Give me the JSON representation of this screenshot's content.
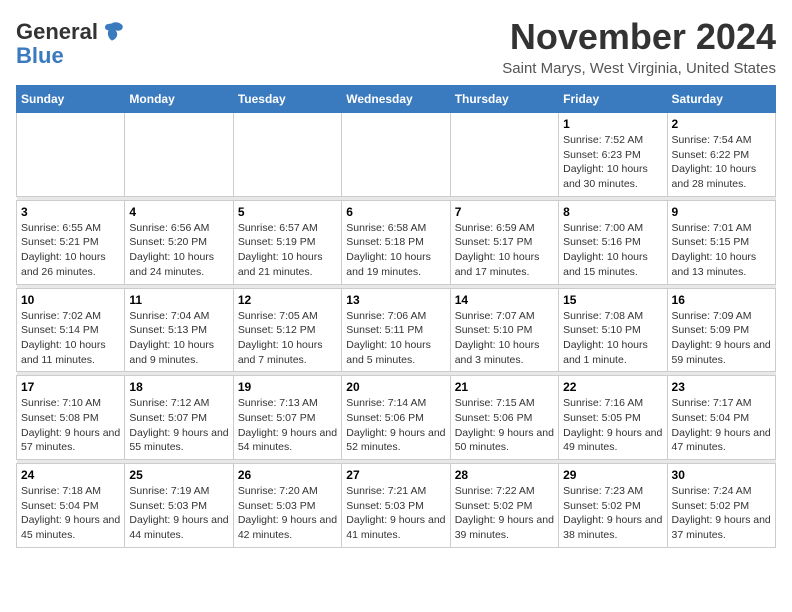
{
  "logo": {
    "general": "General",
    "blue": "Blue"
  },
  "title": "November 2024",
  "subtitle": "Saint Marys, West Virginia, United States",
  "weekdays": [
    "Sunday",
    "Monday",
    "Tuesday",
    "Wednesday",
    "Thursday",
    "Friday",
    "Saturday"
  ],
  "weeks": [
    [
      {
        "day": "",
        "info": ""
      },
      {
        "day": "",
        "info": ""
      },
      {
        "day": "",
        "info": ""
      },
      {
        "day": "",
        "info": ""
      },
      {
        "day": "",
        "info": ""
      },
      {
        "day": "1",
        "info": "Sunrise: 7:52 AM\nSunset: 6:23 PM\nDaylight: 10 hours and 30 minutes."
      },
      {
        "day": "2",
        "info": "Sunrise: 7:54 AM\nSunset: 6:22 PM\nDaylight: 10 hours and 28 minutes."
      }
    ],
    [
      {
        "day": "3",
        "info": "Sunrise: 6:55 AM\nSunset: 5:21 PM\nDaylight: 10 hours and 26 minutes."
      },
      {
        "day": "4",
        "info": "Sunrise: 6:56 AM\nSunset: 5:20 PM\nDaylight: 10 hours and 24 minutes."
      },
      {
        "day": "5",
        "info": "Sunrise: 6:57 AM\nSunset: 5:19 PM\nDaylight: 10 hours and 21 minutes."
      },
      {
        "day": "6",
        "info": "Sunrise: 6:58 AM\nSunset: 5:18 PM\nDaylight: 10 hours and 19 minutes."
      },
      {
        "day": "7",
        "info": "Sunrise: 6:59 AM\nSunset: 5:17 PM\nDaylight: 10 hours and 17 minutes."
      },
      {
        "day": "8",
        "info": "Sunrise: 7:00 AM\nSunset: 5:16 PM\nDaylight: 10 hours and 15 minutes."
      },
      {
        "day": "9",
        "info": "Sunrise: 7:01 AM\nSunset: 5:15 PM\nDaylight: 10 hours and 13 minutes."
      }
    ],
    [
      {
        "day": "10",
        "info": "Sunrise: 7:02 AM\nSunset: 5:14 PM\nDaylight: 10 hours and 11 minutes."
      },
      {
        "day": "11",
        "info": "Sunrise: 7:04 AM\nSunset: 5:13 PM\nDaylight: 10 hours and 9 minutes."
      },
      {
        "day": "12",
        "info": "Sunrise: 7:05 AM\nSunset: 5:12 PM\nDaylight: 10 hours and 7 minutes."
      },
      {
        "day": "13",
        "info": "Sunrise: 7:06 AM\nSunset: 5:11 PM\nDaylight: 10 hours and 5 minutes."
      },
      {
        "day": "14",
        "info": "Sunrise: 7:07 AM\nSunset: 5:10 PM\nDaylight: 10 hours and 3 minutes."
      },
      {
        "day": "15",
        "info": "Sunrise: 7:08 AM\nSunset: 5:10 PM\nDaylight: 10 hours and 1 minute."
      },
      {
        "day": "16",
        "info": "Sunrise: 7:09 AM\nSunset: 5:09 PM\nDaylight: 9 hours and 59 minutes."
      }
    ],
    [
      {
        "day": "17",
        "info": "Sunrise: 7:10 AM\nSunset: 5:08 PM\nDaylight: 9 hours and 57 minutes."
      },
      {
        "day": "18",
        "info": "Sunrise: 7:12 AM\nSunset: 5:07 PM\nDaylight: 9 hours and 55 minutes."
      },
      {
        "day": "19",
        "info": "Sunrise: 7:13 AM\nSunset: 5:07 PM\nDaylight: 9 hours and 54 minutes."
      },
      {
        "day": "20",
        "info": "Sunrise: 7:14 AM\nSunset: 5:06 PM\nDaylight: 9 hours and 52 minutes."
      },
      {
        "day": "21",
        "info": "Sunrise: 7:15 AM\nSunset: 5:06 PM\nDaylight: 9 hours and 50 minutes."
      },
      {
        "day": "22",
        "info": "Sunrise: 7:16 AM\nSunset: 5:05 PM\nDaylight: 9 hours and 49 minutes."
      },
      {
        "day": "23",
        "info": "Sunrise: 7:17 AM\nSunset: 5:04 PM\nDaylight: 9 hours and 47 minutes."
      }
    ],
    [
      {
        "day": "24",
        "info": "Sunrise: 7:18 AM\nSunset: 5:04 PM\nDaylight: 9 hours and 45 minutes."
      },
      {
        "day": "25",
        "info": "Sunrise: 7:19 AM\nSunset: 5:03 PM\nDaylight: 9 hours and 44 minutes."
      },
      {
        "day": "26",
        "info": "Sunrise: 7:20 AM\nSunset: 5:03 PM\nDaylight: 9 hours and 42 minutes."
      },
      {
        "day": "27",
        "info": "Sunrise: 7:21 AM\nSunset: 5:03 PM\nDaylight: 9 hours and 41 minutes."
      },
      {
        "day": "28",
        "info": "Sunrise: 7:22 AM\nSunset: 5:02 PM\nDaylight: 9 hours and 39 minutes."
      },
      {
        "day": "29",
        "info": "Sunrise: 7:23 AM\nSunset: 5:02 PM\nDaylight: 9 hours and 38 minutes."
      },
      {
        "day": "30",
        "info": "Sunrise: 7:24 AM\nSunset: 5:02 PM\nDaylight: 9 hours and 37 minutes."
      }
    ]
  ]
}
